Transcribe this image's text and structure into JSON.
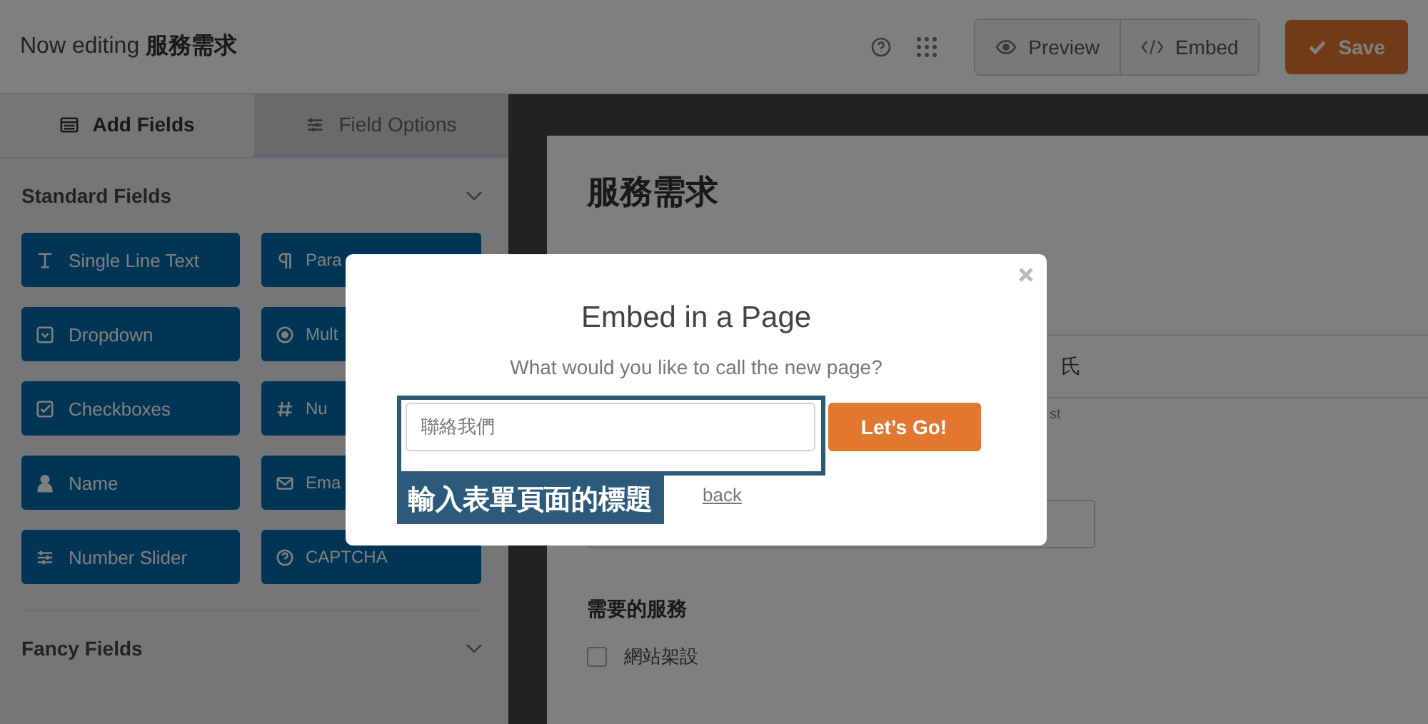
{
  "header": {
    "prefix": "Now editing",
    "form_name": "服務需求",
    "buttons": [
      {
        "label": "Preview",
        "kind": "preview"
      },
      {
        "label": "Embed",
        "kind": "embed"
      }
    ],
    "save": "Save"
  },
  "sidebar": {
    "tabs": [
      {
        "label": "Add Fields",
        "selected": true,
        "kind": "list"
      },
      {
        "label": "Field Options",
        "selected": false,
        "kind": "sliders"
      }
    ],
    "sections": [
      {
        "title": "Standard Fields",
        "fields": [
          {
            "label": "Single Line Text",
            "kind": "text"
          },
          {
            "label": "Para",
            "kind": "paragraph"
          },
          {
            "label": "Dropdown",
            "kind": "dropdown"
          },
          {
            "label": "Mult",
            "kind": "radio"
          },
          {
            "label": "Checkboxes",
            "kind": "checkbox"
          },
          {
            "label": "Nu",
            "kind": "number"
          },
          {
            "label": "Name",
            "kind": "person"
          },
          {
            "label": "Ema",
            "kind": "email"
          },
          {
            "label": "Number Slider",
            "kind": "sliders"
          },
          {
            "label": "CAPTCHA",
            "kind": "question"
          }
        ]
      },
      {
        "title": "Fancy Fields"
      }
    ]
  },
  "form": {
    "title": "服務需求",
    "name_fragment": "氏",
    "hint_fragment": "st",
    "section_label": "需要的服務",
    "options": [
      {
        "label": "網站架設",
        "checked": false
      }
    ]
  },
  "dialog": {
    "title": "Embed in a Page",
    "prompt": "What would you like to call the new page?",
    "placeholder": "聯絡我們",
    "submit": "Let’s Go!",
    "link": "back"
  },
  "annotation": {
    "label": "輸入表單頁面的標題"
  }
}
